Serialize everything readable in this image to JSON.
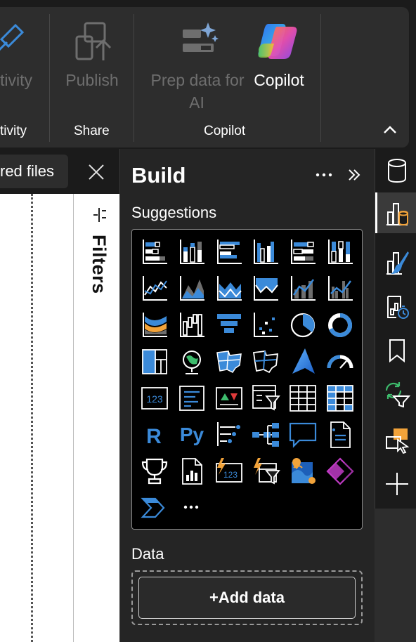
{
  "ribbon": {
    "groups": {
      "sensitivity": "tivity",
      "share": "Share",
      "copilot": "Copilot"
    },
    "buttons": {
      "sensitivity_label": "tivity",
      "sensitivity_label2": "",
      "publish_label": "Publish",
      "prep_data_label_1": "Prep data for",
      "prep_data_label_2": "AI",
      "copilot_label": "Copilot"
    }
  },
  "tabs": {
    "shared_files": "red files"
  },
  "filters": {
    "label": "Filters"
  },
  "build": {
    "title": "Build",
    "suggestions_label": "Suggestions",
    "data_label": "Data",
    "add_data_label": "+Add data",
    "viz_icons": [
      "stacked-bar-chart-icon",
      "stacked-column-chart-icon",
      "clustered-bar-chart-icon",
      "clustered-column-chart-icon",
      "100-stacked-bar-chart-icon",
      "100-stacked-column-chart-icon",
      "line-chart-icon",
      "area-chart-icon",
      "stacked-area-chart-icon",
      "100-stacked-area-chart-icon",
      "line-stacked-column-chart-icon",
      "line-clustered-column-chart-icon",
      "ribbon-chart-icon",
      "waterfall-chart-icon",
      "funnel-chart-icon",
      "scatter-chart-icon",
      "pie-chart-icon",
      "donut-chart-icon",
      "treemap-icon",
      "map-icon",
      "filled-map-icon",
      "shape-map-icon",
      "azure-map-icon",
      "gauge-icon",
      "card-icon",
      "multi-row-card-icon",
      "kpi-icon",
      "slicer-icon",
      "table-icon",
      "matrix-icon",
      "r-script-visual-icon",
      "python-visual-icon",
      "key-influencers-icon",
      "decomposition-tree-icon",
      "qa-icon",
      "paginated-report-icon",
      "goals-icon",
      "narrative-icon",
      "card-new-icon",
      "slicer-new-icon",
      "arcgis-map-icon",
      "power-apps-icon",
      "power-automate-icon",
      "more-visuals-icon"
    ],
    "more_visuals": "..."
  },
  "rail": {
    "items": [
      "data-pane-icon",
      "build-pane-icon",
      "format-pane-icon",
      "performance-analyzer-icon",
      "bookmarks-icon",
      "sync-slicers-icon",
      "selection-pane-icon",
      "add-pane-icon"
    ],
    "active_index": 1
  },
  "colors": {
    "accent_blue": "#3b8ad9",
    "accent_orange": "#f2a33a",
    "accent_green": "#3dbb6c",
    "panel_bg": "#252525",
    "ribbon_bg": "#2d2d2d"
  }
}
